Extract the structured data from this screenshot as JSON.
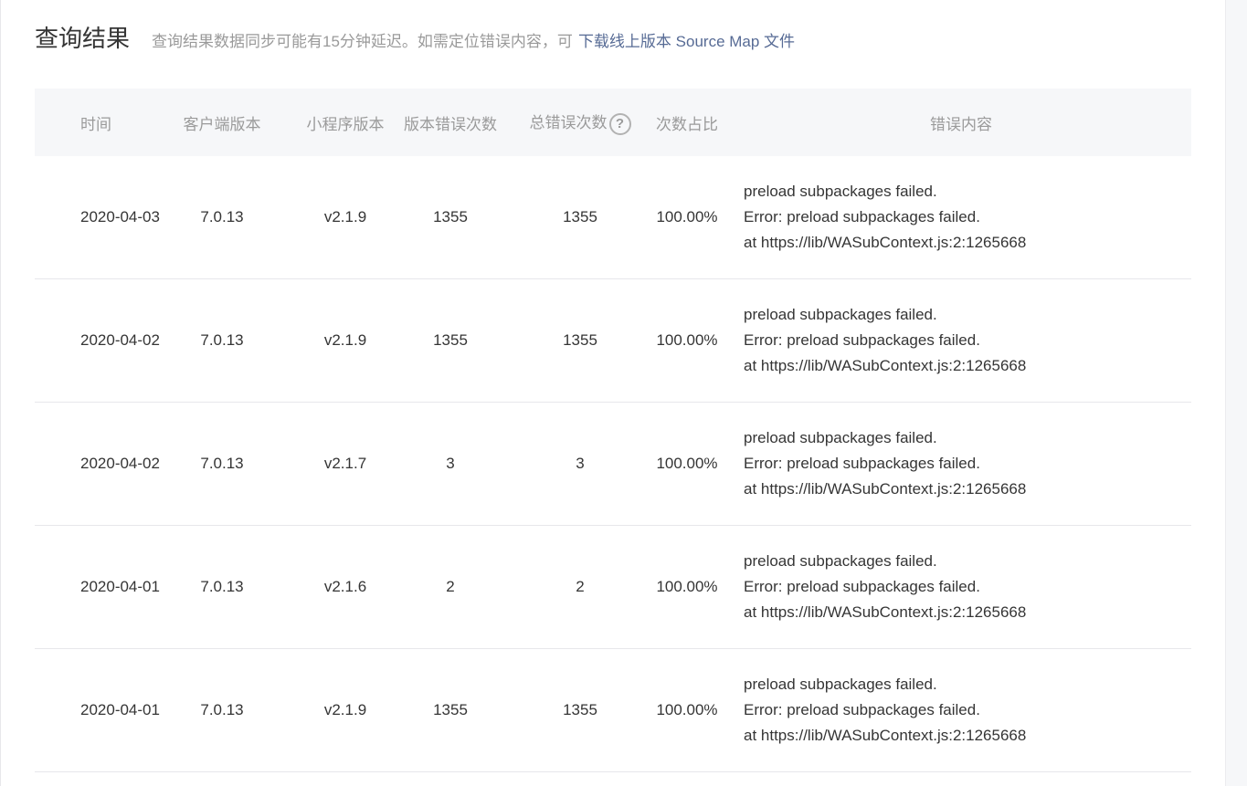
{
  "header": {
    "title": "查询结果",
    "description": "查询结果数据同步可能有15分钟延迟。如需定位错误内容，可",
    "link_text": "下载线上版本 Source Map 文件"
  },
  "table": {
    "columns": {
      "time": "时间",
      "client_version": "客户端版本",
      "mini_version": "小程序版本",
      "version_errors": "版本错误次数",
      "total_errors": "总错误次数",
      "ratio": "次数占比",
      "content": "错误内容"
    },
    "help_icon_glyph": "?",
    "rows": [
      {
        "time": "2020-04-03",
        "client_version": "7.0.13",
        "mini_version": "v2.1.9",
        "version_errors": "1355",
        "total_errors": "1355",
        "ratio": "100.00%",
        "content": [
          "preload subpackages failed.",
          "Error: preload subpackages failed.",
          "at https://lib/WASubContext.js:2:1265668"
        ]
      },
      {
        "time": "2020-04-02",
        "client_version": "7.0.13",
        "mini_version": "v2.1.9",
        "version_errors": "1355",
        "total_errors": "1355",
        "ratio": "100.00%",
        "content": [
          "preload subpackages failed.",
          "Error: preload subpackages failed.",
          "at https://lib/WASubContext.js:2:1265668"
        ]
      },
      {
        "time": "2020-04-02",
        "client_version": "7.0.13",
        "mini_version": "v2.1.7",
        "version_errors": "3",
        "total_errors": "3",
        "ratio": "100.00%",
        "content": [
          "preload subpackages failed.",
          "Error: preload subpackages failed.",
          "at https://lib/WASubContext.js:2:1265668"
        ]
      },
      {
        "time": "2020-04-01",
        "client_version": "7.0.13",
        "mini_version": "v2.1.6",
        "version_errors": "2",
        "total_errors": "2",
        "ratio": "100.00%",
        "content": [
          "preload subpackages failed.",
          "Error: preload subpackages failed.",
          "at https://lib/WASubContext.js:2:1265668"
        ]
      },
      {
        "time": "2020-04-01",
        "client_version": "7.0.13",
        "mini_version": "v2.1.9",
        "version_errors": "1355",
        "total_errors": "1355",
        "ratio": "100.00%",
        "content": [
          "preload subpackages failed.",
          "Error: preload subpackages failed.",
          "at https://lib/WASubContext.js:2:1265668"
        ]
      }
    ]
  },
  "colors": {
    "link": "#576b95",
    "header_bg": "#f6f7f9",
    "muted_text": "#9a9a9a",
    "body_text": "#353535",
    "divider": "#e7e7eb"
  }
}
